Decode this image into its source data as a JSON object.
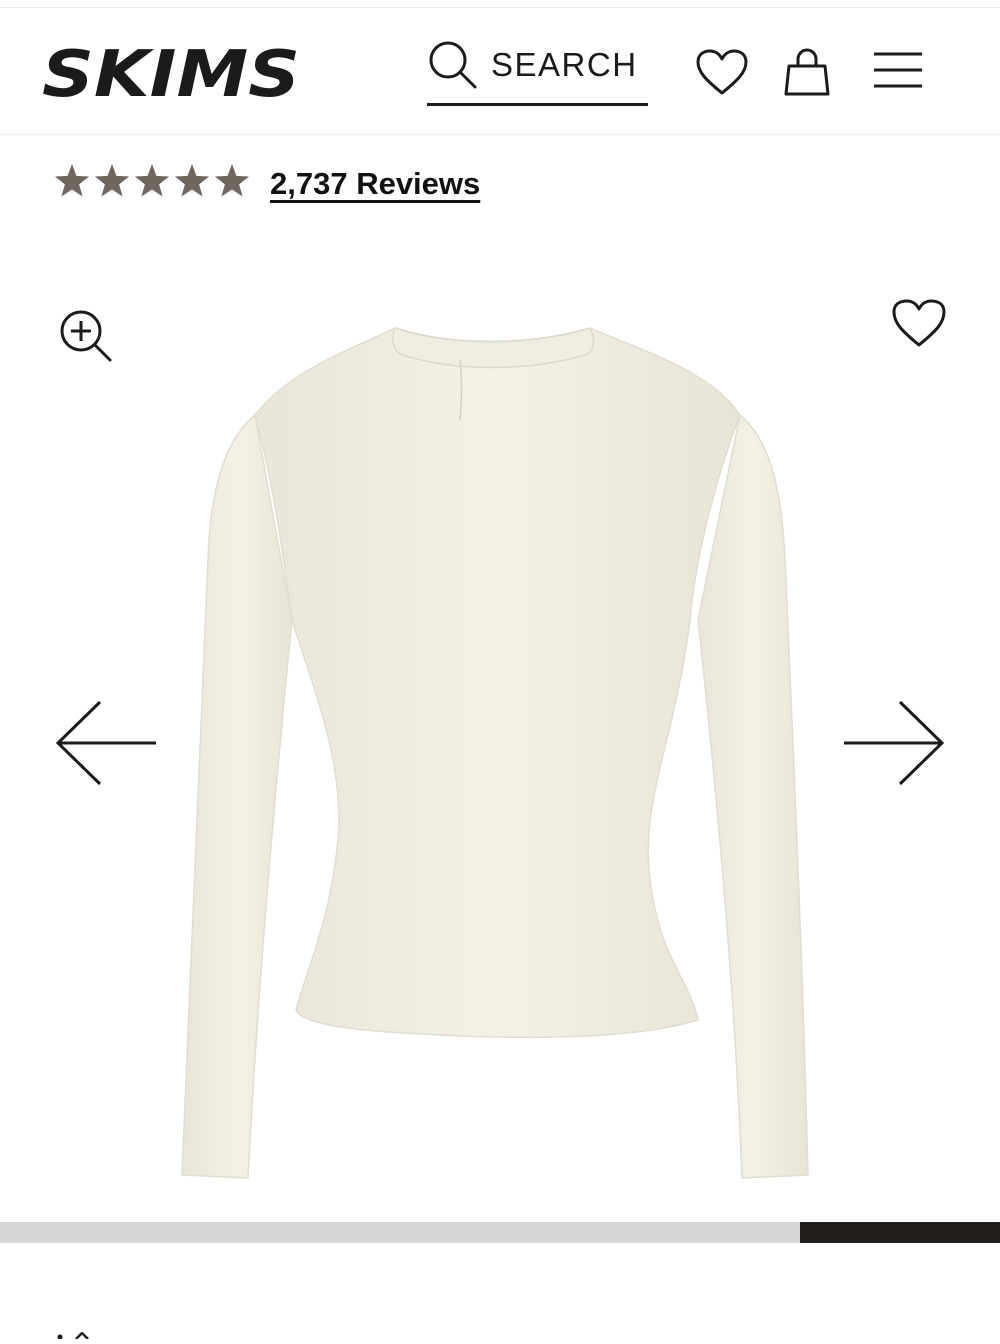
{
  "header": {
    "logo_text": "SKIMS",
    "search_label": "SEARCH",
    "icons": [
      "search-icon",
      "heart-icon",
      "shopping-bag-icon",
      "menu-icon"
    ]
  },
  "rating": {
    "stars": 5,
    "reviews_label": "2,737 Reviews",
    "star_color": "#6f665e"
  },
  "gallery": {
    "icons": [
      "zoom-in-icon",
      "heart-icon",
      "arrow-left-icon",
      "arrow-right-icon"
    ],
    "product_color": "#f2efe4",
    "progress": {
      "start": 0.8,
      "end": 1.0
    }
  },
  "colors": {
    "text": "#1d1b19",
    "track": "#d8d6d4",
    "progress_fill": "#221f1c"
  }
}
